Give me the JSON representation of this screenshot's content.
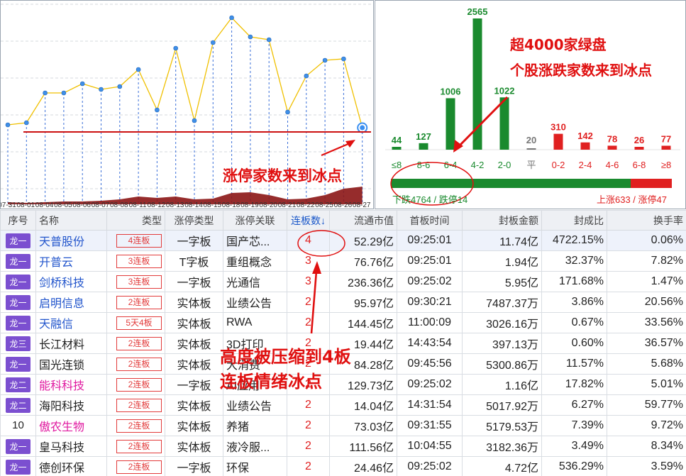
{
  "left_panel": {
    "x_dates": [
      "07-31",
      "08-01",
      "08-04",
      "08-05",
      "08-06",
      "08-07",
      "08-08",
      "08-11",
      "08-12",
      "08-13",
      "08-14",
      "08-15",
      "08-18",
      "08-19",
      "08-20",
      "08-21",
      "08-22",
      "08-25",
      "08-26",
      "08-27"
    ],
    "annotation": "涨停家数来到冰点"
  },
  "right_panel": {
    "categories": [
      "≤8",
      "8-6",
      "6-4",
      "4-2",
      "2-0",
      "平",
      "0-2",
      "2-4",
      "4-6",
      "6-8",
      "≥8"
    ],
    "values": [
      44,
      127,
      1006,
      2565,
      1022,
      20,
      310,
      142,
      78,
      26,
      77
    ],
    "colors": [
      "#1a8a2e",
      "#1a8a2e",
      "#1a8a2e",
      "#1a8a2e",
      "#1a8a2e",
      "#777777",
      "#e02020",
      "#e02020",
      "#e02020",
      "#e02020",
      "#e02020"
    ],
    "annotation_line1": "超4000家绿盘",
    "annotation_line2": "个股涨跌家数来到冰点",
    "down_summary": "下跌4764 / 跌停14",
    "up_summary": "上涨633 / 涨停47",
    "down_color": "#1a8a2e",
    "up_color": "#e02020"
  },
  "table": {
    "headers": [
      "序号",
      "名称",
      "类型",
      "涨停类型",
      "涨停关联",
      "连板数↓",
      "流通市值",
      "首板时间",
      "封板金额",
      "封成比",
      "换手率"
    ],
    "rows": [
      {
        "idx": "龙一",
        "idx_tag": true,
        "name": "天普股份",
        "name_color": "blue",
        "type": "4连板",
        "limit_type": "一字板",
        "reason": "国产芯...",
        "boards": "4",
        "cap": "52.29亿",
        "first_time": "09:25:01",
        "seal_amount": "11.74亿",
        "seal_ratio": "4722.15%",
        "turnover": "0.06%"
      },
      {
        "idx": "龙一",
        "idx_tag": true,
        "name": "开普云",
        "name_color": "blue",
        "type": "3连板",
        "limit_type": "T字板",
        "reason": "重组概念",
        "boards": "3",
        "cap": "76.76亿",
        "first_time": "09:25:01",
        "seal_amount": "1.94亿",
        "seal_ratio": "32.37%",
        "turnover": "7.82%"
      },
      {
        "idx": "龙一",
        "idx_tag": true,
        "name": "剑桥科技",
        "name_color": "blue",
        "type": "3连板",
        "limit_type": "一字板",
        "reason": "光通信",
        "boards": "3",
        "cap": "236.36亿",
        "first_time": "09:25:02",
        "seal_amount": "5.95亿",
        "seal_ratio": "171.68%",
        "turnover": "1.47%"
      },
      {
        "idx": "龙一",
        "idx_tag": true,
        "name": "启明信息",
        "name_color": "blue",
        "type": "2连板",
        "limit_type": "实体板",
        "reason": "业绩公告",
        "boards": "2",
        "cap": "95.97亿",
        "first_time": "09:30:21",
        "seal_amount": "7487.37万",
        "seal_ratio": "3.86%",
        "turnover": "20.56%"
      },
      {
        "idx": "龙一",
        "idx_tag": true,
        "name": "天融信",
        "name_color": "blue",
        "type": "5天4板",
        "limit_type": "实体板",
        "reason": "RWA",
        "boards": "2",
        "cap": "144.45亿",
        "first_time": "11:00:09",
        "seal_amount": "3026.16万",
        "seal_ratio": "0.67%",
        "turnover": "33.56%"
      },
      {
        "idx": "龙三",
        "idx_tag": true,
        "name": "长江材料",
        "name_color": "dark",
        "type": "2连板",
        "limit_type": "实体板",
        "reason": "3D打印",
        "boards": "2",
        "cap": "19.44亿",
        "first_time": "14:43:54",
        "seal_amount": "397.13万",
        "seal_ratio": "0.60%",
        "turnover": "36.57%"
      },
      {
        "idx": "龙一",
        "idx_tag": true,
        "name": "国光连锁",
        "name_color": "dark",
        "type": "2连板",
        "limit_type": "实体板",
        "reason": "大消费",
        "boards": "2",
        "cap": "84.28亿",
        "first_time": "09:45:56",
        "seal_amount": "5300.86万",
        "seal_ratio": "11.57%",
        "turnover": "5.68%"
      },
      {
        "idx": "龙二",
        "idx_tag": true,
        "name": "能科科技",
        "name_color": "pink",
        "type": "2连板",
        "limit_type": "一字板",
        "reason": "AI应用",
        "boards": "2",
        "cap": "129.73亿",
        "first_time": "09:25:02",
        "seal_amount": "1.16亿",
        "seal_ratio": "17.82%",
        "turnover": "5.01%"
      },
      {
        "idx": "龙二",
        "idx_tag": true,
        "name": "海阳科技",
        "name_color": "dark",
        "type": "2连板",
        "limit_type": "实体板",
        "reason": "业绩公告",
        "boards": "2",
        "cap": "14.04亿",
        "first_time": "14:31:54",
        "seal_amount": "5017.92万",
        "seal_ratio": "6.27%",
        "turnover": "59.77%"
      },
      {
        "idx": "10",
        "idx_tag": false,
        "name": "傲农生物",
        "name_color": "pink",
        "type": "2连板",
        "limit_type": "实体板",
        "reason": "养猪",
        "boards": "2",
        "cap": "73.03亿",
        "first_time": "09:31:55",
        "seal_amount": "5179.53万",
        "seal_ratio": "7.39%",
        "turnover": "9.72%"
      },
      {
        "idx": "龙一",
        "idx_tag": true,
        "name": "皇马科技",
        "name_color": "dark",
        "type": "2连板",
        "limit_type": "实体板",
        "reason": "液冷服...",
        "boards": "2",
        "cap": "111.56亿",
        "first_time": "10:04:55",
        "seal_amount": "3182.36万",
        "seal_ratio": "3.49%",
        "turnover": "8.34%"
      },
      {
        "idx": "龙一",
        "idx_tag": true,
        "name": "德创环保",
        "name_color": "dark",
        "type": "2连板",
        "limit_type": "一字板",
        "reason": "环保",
        "boards": "2",
        "cap": "24.46亿",
        "first_time": "09:25:02",
        "seal_amount": "4.72亿",
        "seal_ratio": "536.29%",
        "turnover": "3.59%"
      }
    ]
  },
  "table_annotation_line1": "高度被压缩到4板",
  "table_annotation_line2": "连板情绪冰点"
}
